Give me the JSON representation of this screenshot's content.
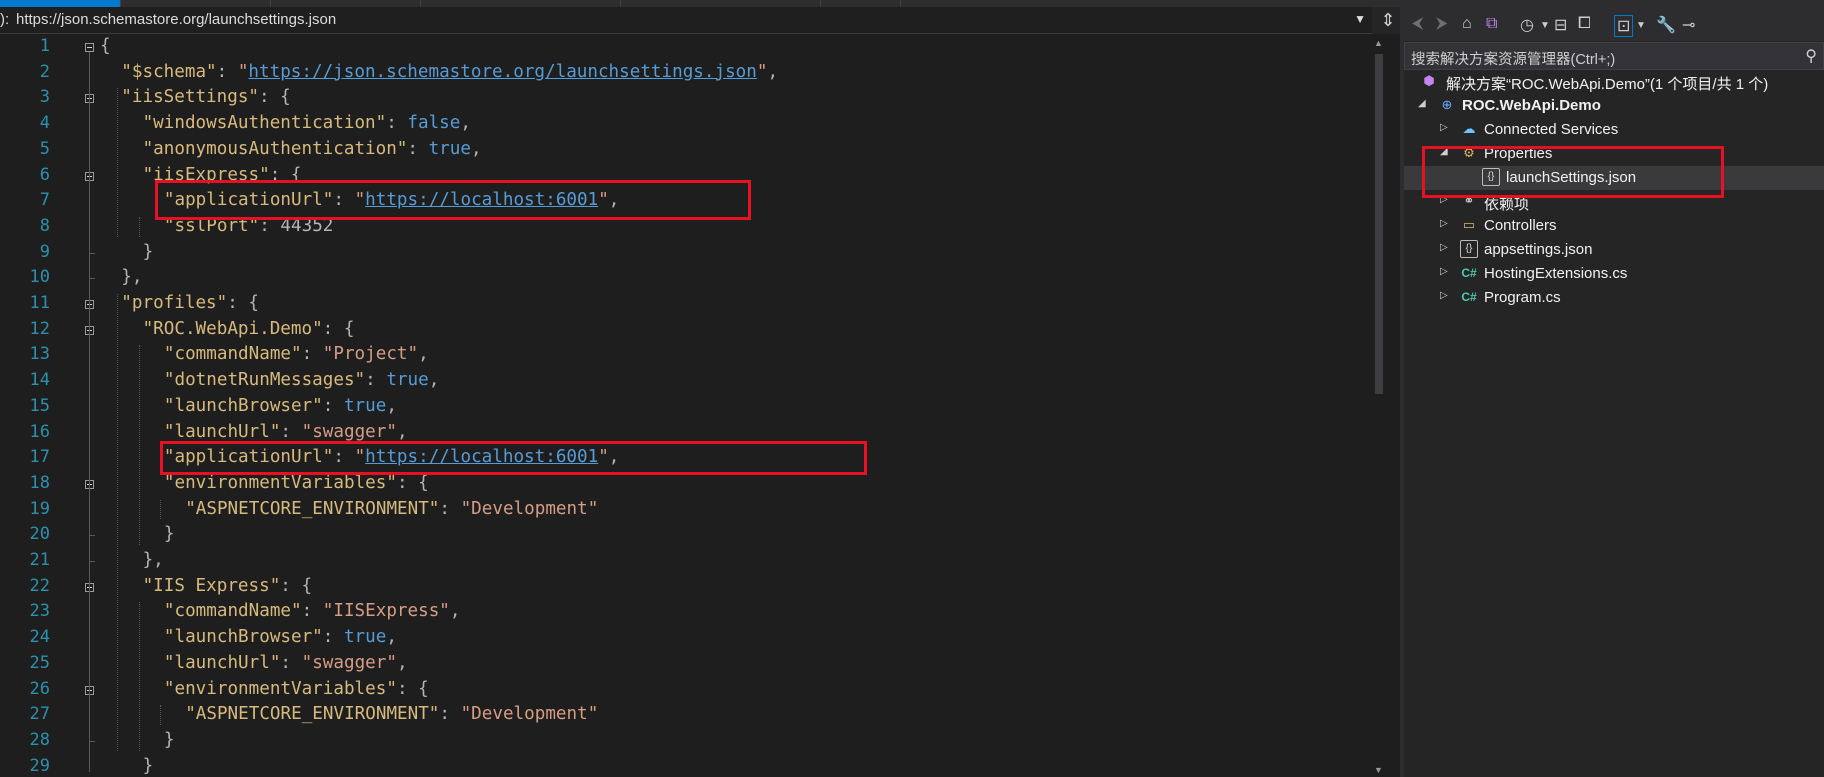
{
  "editor": {
    "nav_prefix": "):",
    "nav_url": "https://json.schemastore.org/launchsettings.json",
    "line_numbers": [
      "1",
      "2",
      "3",
      "4",
      "5",
      "6",
      "7",
      "8",
      "9",
      "10",
      "11",
      "12",
      "13",
      "14",
      "15",
      "16",
      "17",
      "18",
      "19",
      "20",
      "21",
      "22",
      "23",
      "24",
      "25",
      "26",
      "27",
      "28",
      "29"
    ],
    "lines": [
      [
        [
          "p",
          "{"
        ]
      ],
      [
        [
          "k",
          "\"$schema\""
        ],
        [
          "p",
          ": "
        ],
        [
          "s",
          "\""
        ],
        [
          "u",
          "https://json.schemastore.org/launchsettings.json"
        ],
        [
          "s",
          "\""
        ],
        [
          "p",
          ","
        ]
      ],
      [
        [
          "k",
          "\"iisSettings\""
        ],
        [
          "p",
          ": {"
        ]
      ],
      [
        [
          "k",
          "\"windowsAuthentication\""
        ],
        [
          "p",
          ": "
        ],
        [
          "b",
          "false"
        ],
        [
          "p",
          ","
        ]
      ],
      [
        [
          "k",
          "\"anonymousAuthentication\""
        ],
        [
          "p",
          ": "
        ],
        [
          "b",
          "true"
        ],
        [
          "p",
          ","
        ]
      ],
      [
        [
          "k",
          "\"iisExpress\""
        ],
        [
          "p",
          ": {"
        ]
      ],
      [
        [
          "k",
          "\"applicationUrl\""
        ],
        [
          "p",
          ": "
        ],
        [
          "s",
          "\""
        ],
        [
          "u",
          "https://localhost:6001"
        ],
        [
          "s",
          "\""
        ],
        [
          "p",
          ","
        ]
      ],
      [
        [
          "k",
          "\"sslPort\""
        ],
        [
          "p",
          ": "
        ],
        [
          "p",
          "44352"
        ]
      ],
      [
        [
          "p",
          "}"
        ]
      ],
      [
        [
          "p",
          "},"
        ]
      ],
      [
        [
          "k",
          "\"profiles\""
        ],
        [
          "p",
          ": {"
        ]
      ],
      [
        [
          "k",
          "\"ROC.WebApi.Demo\""
        ],
        [
          "p",
          ": {"
        ]
      ],
      [
        [
          "k",
          "\"commandName\""
        ],
        [
          "p",
          ": "
        ],
        [
          "s",
          "\"Project\""
        ],
        [
          "p",
          ","
        ]
      ],
      [
        [
          "k",
          "\"dotnetRunMessages\""
        ],
        [
          "p",
          ": "
        ],
        [
          "b",
          "true"
        ],
        [
          "p",
          ","
        ]
      ],
      [
        [
          "k",
          "\"launchBrowser\""
        ],
        [
          "p",
          ": "
        ],
        [
          "b",
          "true"
        ],
        [
          "p",
          ","
        ]
      ],
      [
        [
          "k",
          "\"launchUrl\""
        ],
        [
          "p",
          ": "
        ],
        [
          "s",
          "\"swagger\""
        ],
        [
          "p",
          ","
        ]
      ],
      [
        [
          "k",
          "\"applicationUrl\""
        ],
        [
          "p",
          ": "
        ],
        [
          "s",
          "\""
        ],
        [
          "u",
          "https://localhost:6001"
        ],
        [
          "s",
          "\""
        ],
        [
          "p",
          ","
        ]
      ],
      [
        [
          "k",
          "\"environmentVariables\""
        ],
        [
          "p",
          ": {"
        ]
      ],
      [
        [
          "k",
          "\"ASPNETCORE_ENVIRONMENT\""
        ],
        [
          "p",
          ": "
        ],
        [
          "s",
          "\"Development\""
        ]
      ],
      [
        [
          "p",
          "}"
        ]
      ],
      [
        [
          "p",
          "},"
        ]
      ],
      [
        [
          "k",
          "\"IIS Express\""
        ],
        [
          "p",
          ": {"
        ]
      ],
      [
        [
          "k",
          "\"commandName\""
        ],
        [
          "p",
          ": "
        ],
        [
          "s",
          "\"IISExpress\""
        ],
        [
          "p",
          ","
        ]
      ],
      [
        [
          "k",
          "\"launchBrowser\""
        ],
        [
          "p",
          ": "
        ],
        [
          "b",
          "true"
        ],
        [
          "p",
          ","
        ]
      ],
      [
        [
          "k",
          "\"launchUrl\""
        ],
        [
          "p",
          ": "
        ],
        [
          "s",
          "\"swagger\""
        ],
        [
          "p",
          ","
        ]
      ],
      [
        [
          "k",
          "\"environmentVariables\""
        ],
        [
          "p",
          ": {"
        ]
      ],
      [
        [
          "k",
          "\"ASPNETCORE_ENVIRONMENT\""
        ],
        [
          "p",
          ": "
        ],
        [
          "s",
          "\"Development\""
        ]
      ],
      [
        [
          "p",
          "}"
        ]
      ],
      [
        [
          "p",
          "}"
        ]
      ]
    ],
    "indents": [
      0,
      1,
      1,
      2,
      2,
      2,
      3,
      3,
      2,
      1,
      1,
      2,
      3,
      3,
      3,
      3,
      3,
      3,
      4,
      3,
      2,
      2,
      3,
      3,
      3,
      3,
      4,
      3,
      2
    ]
  },
  "solution_explorer": {
    "search_placeholder": "搜索解决方案资源管理器(Ctrl+;)",
    "items": [
      {
        "label": "解决方案“ROC.WebApi.Demo”(1 个项目/共 1 个)",
        "icon": "solution-icon",
        "level": 0,
        "arrow": "",
        "bold": false
      },
      {
        "label": "ROC.WebApi.Demo",
        "icon": "web-project-icon",
        "level": 0,
        "arrow": "◢",
        "bold": true
      },
      {
        "label": "Connected Services",
        "icon": "connected-services-icon",
        "level": 1,
        "arrow": "▷",
        "bold": false
      },
      {
        "label": "Properties",
        "icon": "properties-icon",
        "level": 1,
        "arrow": "◢",
        "bold": false
      },
      {
        "label": "launchSettings.json",
        "icon": "json-file-icon",
        "level": 2,
        "arrow": "",
        "bold": false,
        "selected": true
      },
      {
        "label": "依赖项",
        "icon": "dependencies-icon",
        "level": 1,
        "arrow": "▷",
        "bold": false
      },
      {
        "label": "Controllers",
        "icon": "folder-icon",
        "level": 1,
        "arrow": "▷",
        "bold": false
      },
      {
        "label": "appsettings.json",
        "icon": "json-file-icon",
        "level": 1,
        "arrow": "▷",
        "bold": false
      },
      {
        "label": "HostingExtensions.cs",
        "icon": "csharp-file-icon",
        "level": 1,
        "arrow": "▷",
        "bold": false
      },
      {
        "label": "Program.cs",
        "icon": "csharp-file-icon",
        "level": 1,
        "arrow": "▷",
        "bold": false
      }
    ]
  }
}
